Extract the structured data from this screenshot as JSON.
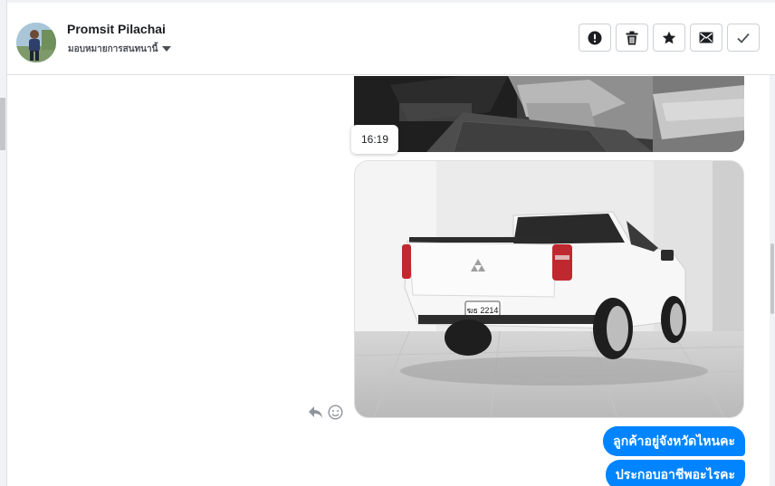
{
  "conversation": {
    "contact_name": "Promsit Pilachai",
    "assign_label": "มอบหมายการสนทนานี้",
    "avatar_icon": "avatar"
  },
  "actions": [
    {
      "name": "report-button",
      "icon": "exclamation-circle-icon"
    },
    {
      "name": "delete-button",
      "icon": "trash-icon"
    },
    {
      "name": "star-button",
      "icon": "star-icon"
    },
    {
      "name": "mark-unread-button",
      "icon": "envelope-icon"
    },
    {
      "name": "mark-done-button",
      "icon": "checkmark-icon"
    }
  ],
  "messages": {
    "timestamp": "16:19",
    "bubble_1": "ลูกค้าอยู่จังหวัดไหนคะ",
    "bubble_2": "ประกอบอาชีพอะไรคะ"
  },
  "photo_truck": {
    "plate_text": "ฆธ 2214"
  },
  "colors": {
    "bubble_bg": "#0084ff",
    "bubble_text": "#ffffff",
    "icon_dark": "#1c1e21",
    "icon_grey": "#90949c"
  }
}
